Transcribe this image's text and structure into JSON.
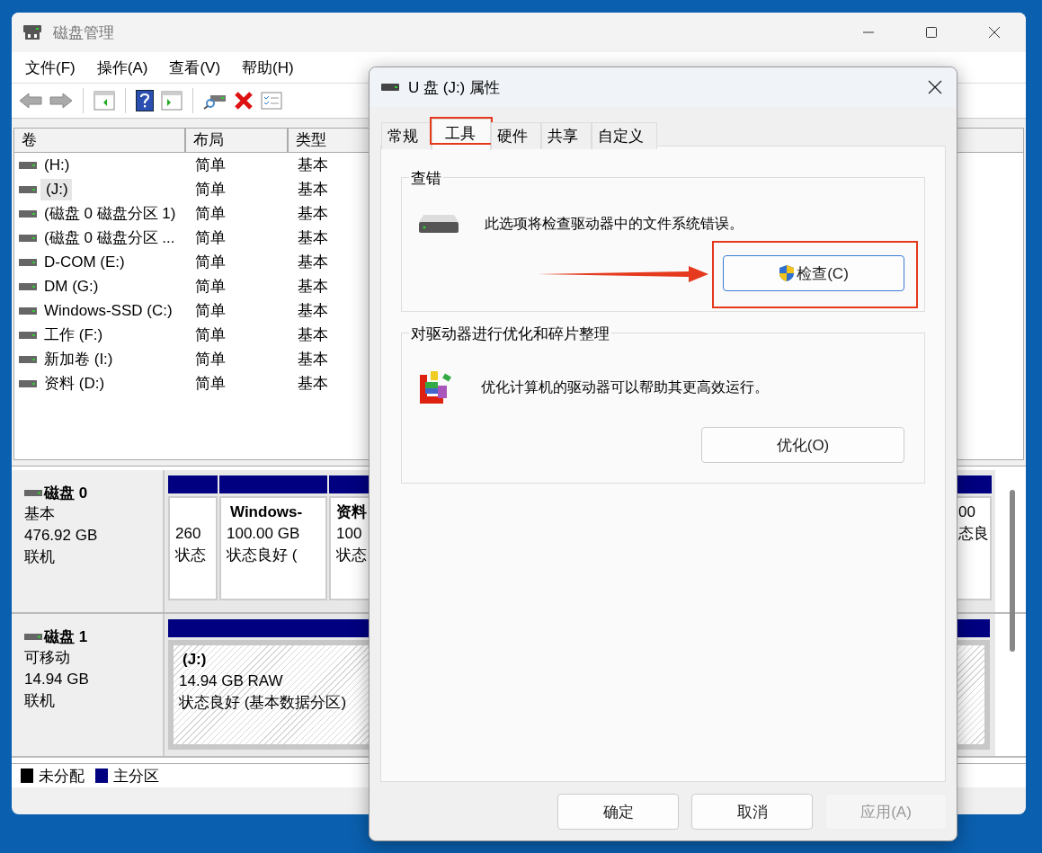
{
  "main_window": {
    "title": "磁盘管理",
    "menu": [
      "文件(F)",
      "操作(A)",
      "查看(V)",
      "帮助(H)"
    ],
    "volume_list": {
      "columns": [
        "卷",
        "布局",
        "类型"
      ],
      "rows": [
        {
          "name": "(H:)",
          "layout": "简单",
          "type": "基本",
          "selected": false
        },
        {
          "name": "(J:)",
          "layout": "简单",
          "type": "基本",
          "selected": true
        },
        {
          "name": "(磁盘 0 磁盘分区 1)",
          "layout": "简单",
          "type": "基本",
          "selected": false
        },
        {
          "name": "(磁盘 0 磁盘分区 ...",
          "layout": "简单",
          "type": "基本",
          "selected": false
        },
        {
          "name": "D-COM (E:)",
          "layout": "简单",
          "type": "基本",
          "selected": false
        },
        {
          "name": "DM (G:)",
          "layout": "简单",
          "type": "基本",
          "selected": false
        },
        {
          "name": "Windows-SSD (C:)",
          "layout": "简单",
          "type": "基本",
          "selected": false
        },
        {
          "name": "工作 (F:)",
          "layout": "简单",
          "type": "基本",
          "selected": false
        },
        {
          "name": "新加卷 (I:)",
          "layout": "简单",
          "type": "基本",
          "selected": false
        },
        {
          "name": "资料 (D:)",
          "layout": "简单",
          "type": "基本",
          "selected": false
        }
      ]
    },
    "disks": [
      {
        "name": "磁盘 0",
        "type": "基本",
        "size": "476.92 GB",
        "status": "联机",
        "partitions": [
          {
            "kind": "primary",
            "lines": [
              "260",
              "状态"
            ]
          },
          {
            "kind": "primary",
            "title": "Windows-",
            "lines": [
              "100.00 GB",
              "状态良好 ("
            ]
          },
          {
            "kind": "primary",
            "title": "资料",
            "lines": [
              "100",
              "状态"
            ]
          },
          {
            "kind": "primary",
            "lines": [
              "00",
              "态良"
            ]
          }
        ]
      },
      {
        "name": "磁盘 1",
        "type": "可移动",
        "size": "14.94 GB",
        "status": "联机",
        "partitions": [
          {
            "kind": "raw",
            "title": "(J:)",
            "lines": [
              "14.94 GB RAW",
              "状态良好 (基本数据分区)"
            ]
          }
        ]
      }
    ],
    "legend": [
      {
        "label": "未分配",
        "color": "#000000"
      },
      {
        "label": "主分区",
        "color": "#000080"
      }
    ]
  },
  "dialog": {
    "title": "U 盘 (J:) 属性",
    "tabs": [
      {
        "label": "常规",
        "selected": false
      },
      {
        "label": "工具",
        "selected": true
      },
      {
        "label": "硬件",
        "selected": false
      },
      {
        "label": "共享",
        "selected": false
      },
      {
        "label": "自定义",
        "selected": false
      }
    ],
    "groups": [
      {
        "kind": "check",
        "title": "查错",
        "description": "此选项将检查驱动器中的文件系统错误。",
        "button": "检查(C)"
      },
      {
        "kind": "optimize",
        "title": "对驱动器进行优化和碎片整理",
        "description": "优化计算机的驱动器可以帮助其更高效运行。",
        "button": "优化(O)"
      }
    ],
    "buttons": [
      {
        "label": "确定",
        "disabled": false
      },
      {
        "label": "取消",
        "disabled": false
      },
      {
        "label": "应用(A)",
        "disabled": true
      }
    ]
  }
}
